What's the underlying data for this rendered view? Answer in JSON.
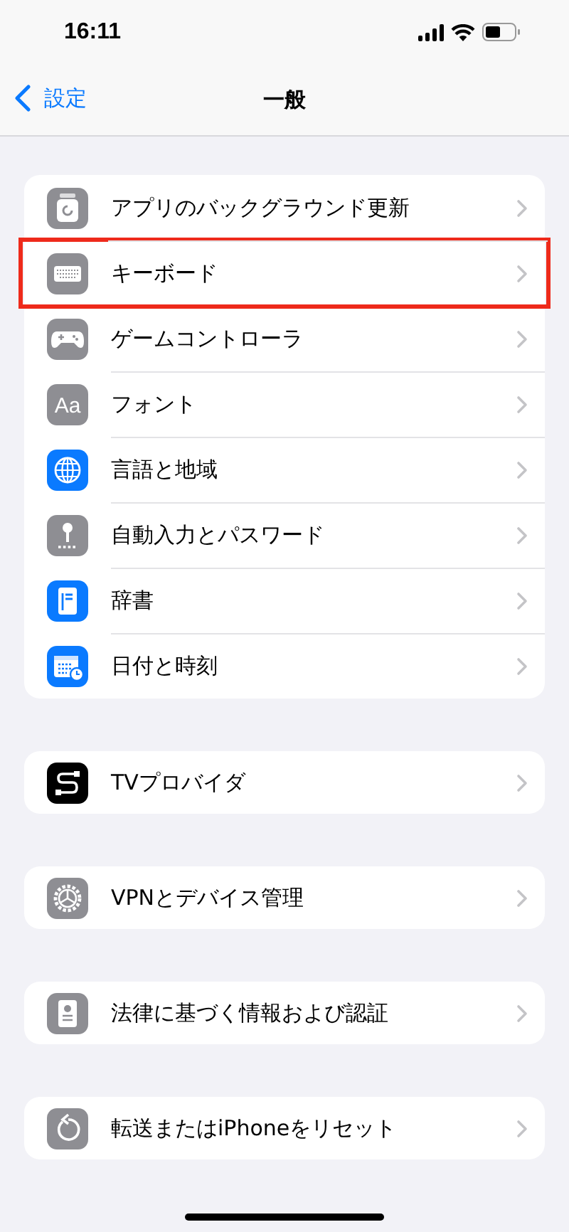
{
  "status_bar": {
    "time": "16:11"
  },
  "nav": {
    "back": "設定",
    "title": "一般"
  },
  "groups": [
    {
      "items": [
        {
          "kind": "refresh",
          "label": "アプリのバックグラウンド更新",
          "highlighted": false
        },
        {
          "kind": "keyboard",
          "label": "キーボード",
          "highlighted": true
        },
        {
          "kind": "gamepad",
          "label": "ゲームコントローラ",
          "highlighted": false
        },
        {
          "kind": "font",
          "label": "フォント",
          "glyph": "Aa",
          "highlighted": false
        },
        {
          "kind": "globe",
          "label": "言語と地域",
          "highlighted": false
        },
        {
          "kind": "key",
          "label": "自動入力とパスワード",
          "highlighted": false
        },
        {
          "kind": "book",
          "label": "辞書",
          "highlighted": false
        },
        {
          "kind": "calendar",
          "label": "日付と時刻",
          "highlighted": false
        }
      ]
    },
    {
      "items": [
        {
          "kind": "tv",
          "label": "TVプロバイダ",
          "highlighted": false
        }
      ]
    },
    {
      "items": [
        {
          "kind": "gear",
          "label": "VPNとデバイス管理",
          "highlighted": false
        }
      ]
    },
    {
      "items": [
        {
          "kind": "certificate",
          "label": "法律に基づく情報および認証",
          "highlighted": false
        }
      ]
    },
    {
      "items": [
        {
          "kind": "reset",
          "label": "転送またはiPhoneをリセット",
          "highlighted": false
        }
      ]
    }
  ]
}
